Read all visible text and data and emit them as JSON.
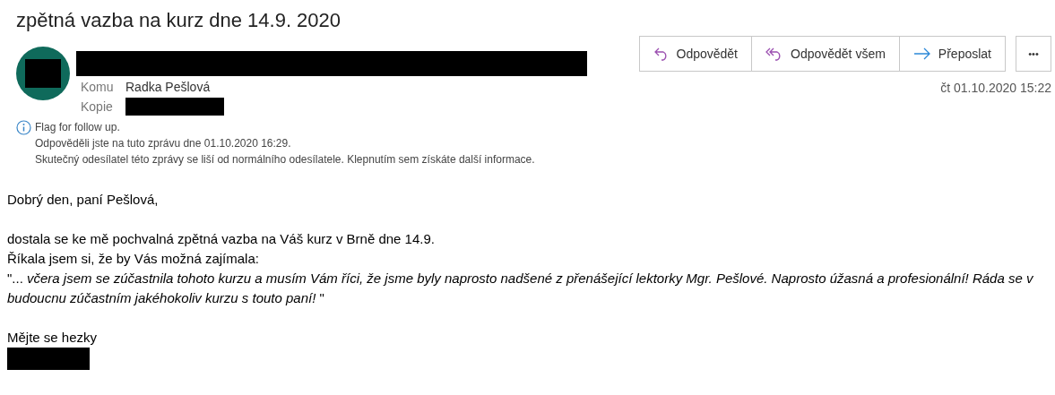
{
  "subject": "zpětná vazba na kurz dne 14.9. 2020",
  "recipients": [
    {
      "label": "Komu",
      "value": "Radka Pešlová"
    },
    {
      "label": "Kopie",
      "redacted": true
    }
  ],
  "info": [
    "Flag for follow up.",
    "Odpověděli jste na tuto zprávu dne 01.10.2020 16:29.",
    "Skutečný odesílatel této zprávy se liší od normálního odesílatele. Klepnutím sem získáte další informace."
  ],
  "actions": [
    {
      "kind": "reply",
      "label": "Odpovědět"
    },
    {
      "kind": "reply_all",
      "label": "Odpovědět všem"
    },
    {
      "kind": "forward",
      "label": "Přeposlat"
    }
  ],
  "more_button": "•••",
  "date": "čt 01.10.2020 15:22",
  "body": [
    {
      "kind": "text",
      "text": "Dobrý den, paní Pešlová,"
    },
    {
      "kind": "blank"
    },
    {
      "kind": "text",
      "text": "dostala se ke mě pochvalná zpětná vazba na Váš kurz v Brně dne 14.9."
    },
    {
      "kind": "text",
      "text": "Říkala jsem si, že by Vás možná zajímala:"
    },
    {
      "kind": "text",
      "text": "\"...  *včera jsem se zúčastnila tohoto kurzu a musím Vám říci, že jsme byly naprosto nadšené z přenášející lektorky Mgr. Pešlové. Naprosto úžasná a profesionální! Ráda se v budoucnu zúčastním jakéhokoliv kurzu s touto paní!* \""
    },
    {
      "kind": "blank"
    },
    {
      "kind": "text",
      "text": "Mějte se hezky"
    },
    {
      "kind": "redacted"
    }
  ]
}
